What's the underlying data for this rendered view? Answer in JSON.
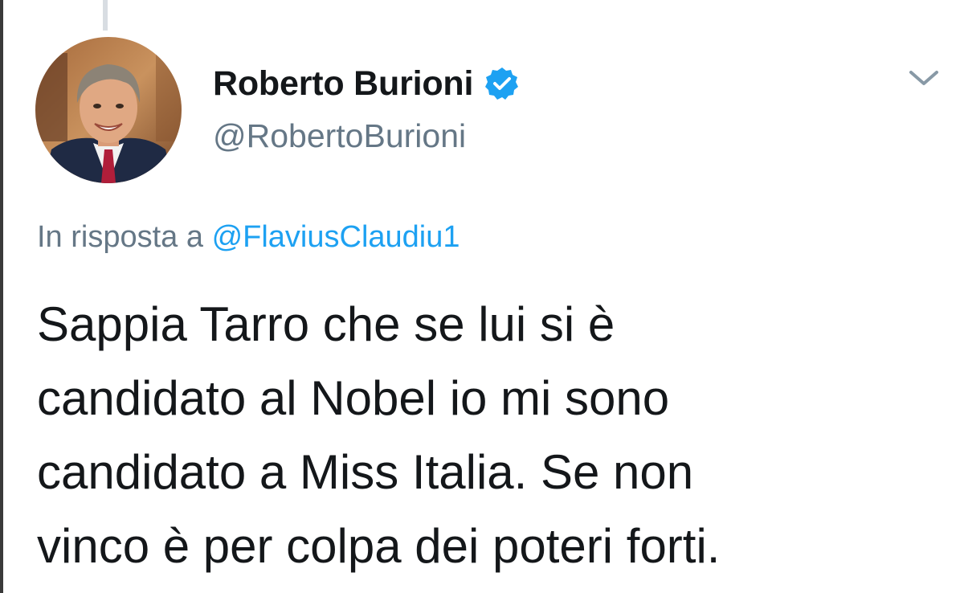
{
  "tweet": {
    "author": {
      "display_name": "Roberto Burioni",
      "handle": "@RobertoBurioni",
      "verified": true
    },
    "reply_prefix": "In risposta a",
    "reply_to": "@FlaviusClaudiu1",
    "text_lines": [
      "Sappia Tarro che se lui si è",
      "candidato al Nobel io mi sono",
      "candidato a Miss Italia. Se non",
      "vinco è per colpa dei poteri forti."
    ]
  },
  "icons": {
    "verified": "verified-badge-icon",
    "menu": "chevron-down-icon"
  },
  "colors": {
    "text": "#14171a",
    "secondary": "#657786",
    "link": "#1da1f2",
    "verified": "#1da1f2"
  }
}
